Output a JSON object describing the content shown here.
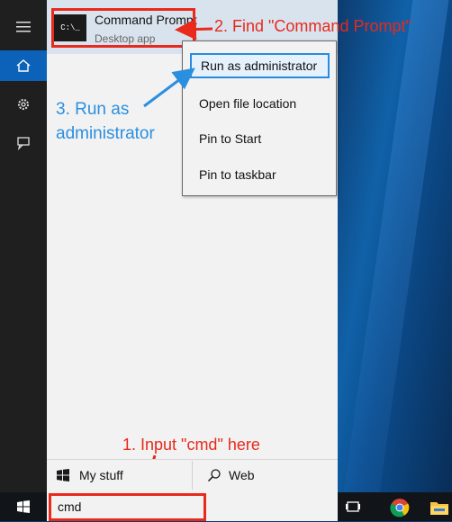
{
  "start_menu": {
    "result": {
      "title": "Command Prompt",
      "subtitle": "Desktop app",
      "tile_text": "C:\\_"
    },
    "context_menu": {
      "items": [
        "Run as administrator",
        "Open file location",
        "Pin to Start",
        "Pin to taskbar"
      ]
    },
    "bottom": {
      "my_stuff": "My stuff",
      "web": "Web"
    }
  },
  "rail": {
    "icons": [
      "hamburger-icon",
      "home-icon",
      "settings-icon",
      "feedback-icon"
    ]
  },
  "taskbar": {
    "search_value": "cmd",
    "icons": [
      "windows-start-icon",
      "task-view-icon",
      "chrome-icon",
      "file-explorer-icon"
    ]
  },
  "annotations": {
    "step1": "1. Input \"cmd\" here",
    "step2": "2. Find \"Command Prompt\"",
    "step3": "3. Run as administrator"
  },
  "colors": {
    "annotation_red": "#e8291c",
    "annotation_blue": "#2b8fe0",
    "rail_selected": "#0b62b8"
  }
}
